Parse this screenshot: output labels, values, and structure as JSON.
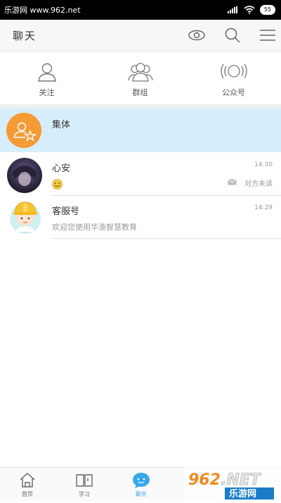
{
  "status_bar": {
    "site": "乐游网 www.962.net",
    "battery": "55"
  },
  "header": {
    "title": "聊天"
  },
  "quick": [
    {
      "label": "关注",
      "icon": "person-icon"
    },
    {
      "label": "群组",
      "icon": "group-icon"
    },
    {
      "label": "公众号",
      "icon": "broadcast-icon"
    }
  ],
  "chats": [
    {
      "name": "集体",
      "time": "",
      "sub": ""
    },
    {
      "name": "心安",
      "time": "14:30",
      "sub": "对方未读"
    },
    {
      "name": "客服号",
      "time": "14:29",
      "sub": "欢迎您使用华渔智慧教育"
    }
  ],
  "bottom_nav": [
    {
      "label": "首页"
    },
    {
      "label": "学习"
    },
    {
      "label": "聊天"
    }
  ],
  "watermark": {
    "text1": "962",
    "text2": ".NET",
    "text3": "乐游网"
  },
  "colors": {
    "accent": "#37a7e8",
    "highlight": "#d6eefc",
    "group_avatar": "#f59a35"
  }
}
